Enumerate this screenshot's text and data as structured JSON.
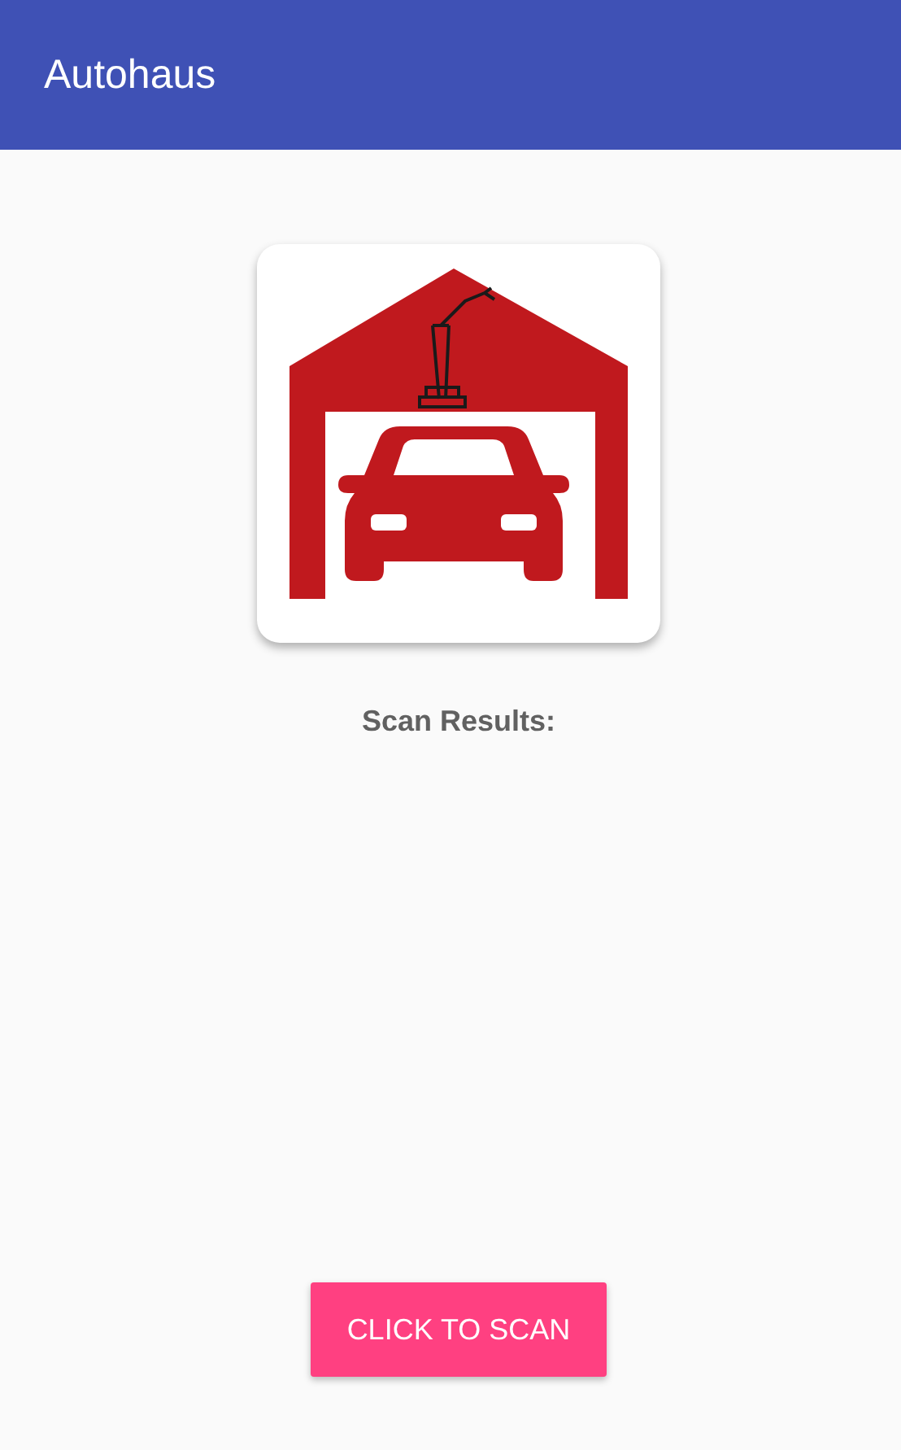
{
  "app_bar": {
    "title": "Autohaus"
  },
  "logo": {
    "kind": "garage-logo"
  },
  "scan_results": {
    "label": "Scan Results:"
  },
  "scan_button": {
    "label": "CLICK TO SCAN"
  }
}
